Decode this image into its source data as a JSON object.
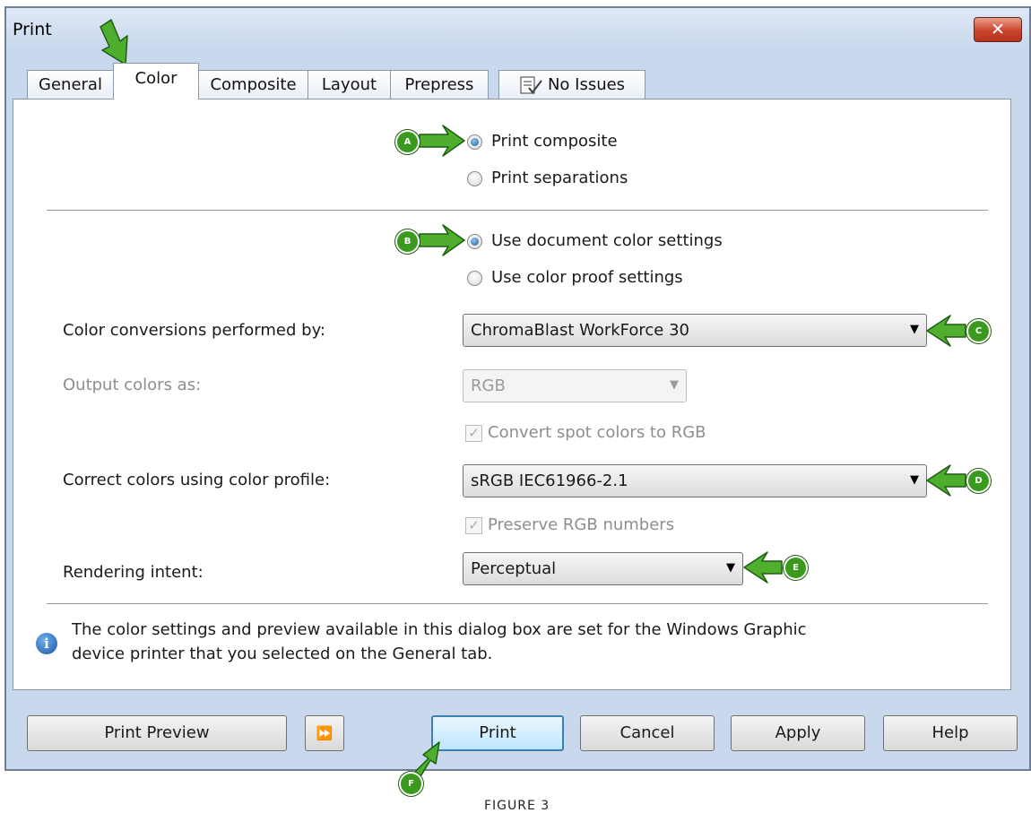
{
  "window": {
    "title": "Print",
    "close_glyph": "✕"
  },
  "tabs": [
    {
      "label": "General"
    },
    {
      "label": "Color"
    },
    {
      "label": "Composite"
    },
    {
      "label": "Layout"
    },
    {
      "label": "Prepress"
    },
    {
      "label": "No Issues",
      "icon": "checklist-icon"
    }
  ],
  "active_tab": "Color",
  "print_mode": {
    "options": [
      "Print composite",
      "Print separations"
    ],
    "selected": "Print composite"
  },
  "color_settings_source": {
    "options": [
      "Use document color settings",
      "Use color proof settings"
    ],
    "selected": "Use document color settings"
  },
  "fields": {
    "conversions_label": "Color conversions performed by:",
    "conversions_value": "ChromaBlast WorkForce 30",
    "output_label": "Output colors as:",
    "output_value": "RGB",
    "convert_spot_label": "Convert spot colors to RGB",
    "correct_label": "Correct colors using color profile:",
    "correct_value": "sRGB IEC61966-2.1",
    "preserve_label": "Preserve RGB numbers",
    "rendering_label": "Rendering intent:",
    "rendering_value": "Perceptual"
  },
  "checkmark_glyph": "✓",
  "dropdown_glyph": "▼",
  "info": {
    "line1": "The color settings and preview available in this dialog box are set for the Windows Graphic",
    "line2": "device printer that you selected on the General tab.",
    "icon_glyph": "i"
  },
  "buttons": {
    "print_preview": "Print Preview",
    "expand_glyph": "⏩",
    "print": "Print",
    "cancel": "Cancel",
    "apply": "Apply",
    "help": "Help"
  },
  "callouts": [
    "A",
    "B",
    "C",
    "D",
    "E",
    "F"
  ],
  "caption": "FIGURE 3",
  "colors": {
    "callout_green": "#3a9a1e",
    "title_bg": "#c9d8ec",
    "close_red": "#c9442e",
    "default_button_blue": "#3c7fb1"
  }
}
